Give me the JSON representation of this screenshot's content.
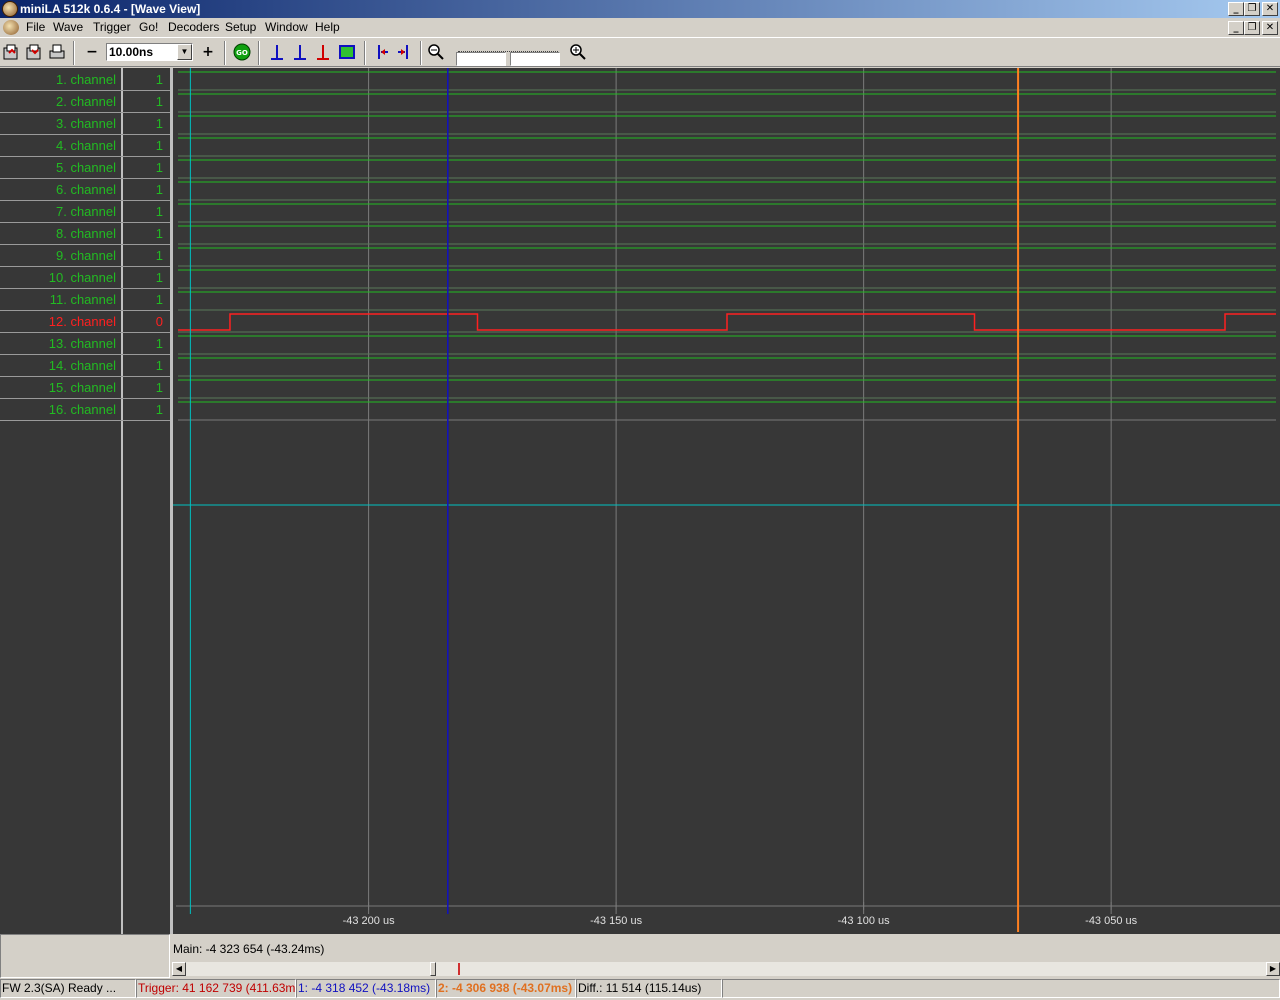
{
  "window": {
    "title": "miniLA 512k 0.6.4 - [Wave View]",
    "controls": [
      "_",
      "❐",
      "✕"
    ]
  },
  "menu": [
    "File",
    "Wave",
    "Trigger",
    "Go!",
    "Decoders",
    "Setup",
    "Window",
    "Help"
  ],
  "toolbar": {
    "zoom_minus": "−",
    "zoom_plus": "+",
    "timebase": "10.00ns",
    "go_label": "GO"
  },
  "channels": [
    {
      "name": "1. channel",
      "value": "1"
    },
    {
      "name": "2. channel",
      "value": "1"
    },
    {
      "name": "3. channel",
      "value": "1"
    },
    {
      "name": "4. channel",
      "value": "1"
    },
    {
      "name": "5. channel",
      "value": "1"
    },
    {
      "name": "6. channel",
      "value": "1"
    },
    {
      "name": "7. channel",
      "value": "1"
    },
    {
      "name": "8. channel",
      "value": "1"
    },
    {
      "name": "9. channel",
      "value": "1"
    },
    {
      "name": "10. channel",
      "value": "1"
    },
    {
      "name": "11. channel",
      "value": "1"
    },
    {
      "name": "12. channel",
      "value": "0"
    },
    {
      "name": "13. channel",
      "value": "1"
    },
    {
      "name": "14. channel",
      "value": "1"
    },
    {
      "name": "15. channel",
      "value": "1"
    },
    {
      "name": "16. channel",
      "value": "1"
    }
  ],
  "highlighted_channel": 12,
  "time_axis": {
    "labels": [
      "-43 200 us",
      "-43 150 us",
      "-43 100 us",
      "-43 050 us"
    ],
    "label_values_us": [
      -43200,
      -43150,
      -43100,
      -43050
    ],
    "view_start_us": -43238.5,
    "view_end_us": -43016.7
  },
  "wave": {
    "channel12_toggles_us": [
      -43228,
      -43178,
      -43127.6,
      -43077.6,
      -43027
    ],
    "channel12_initial_level": 0
  },
  "cursors": {
    "trigger_us": -43236,
    "cursor1_us": -43184,
    "cursor2_us": -43068.8
  },
  "colors": {
    "background": "#373737",
    "signal": "#22bb22",
    "highlight": "#ff2020",
    "grid": "#7a7a7a",
    "trigger": "#00c0c0",
    "cursor1": "#1010c0",
    "cursor2": "#ff8020"
  },
  "main_readout": "Main: -4 323 654  (-43.24ms)",
  "status": {
    "fw": "FW 2.3(SA) Ready ...",
    "trigger": "Trigger: 41 162 739  (411.63ms)",
    "cursor1": "1: -4 318 452  (-43.18ms)",
    "cursor2": "2: -4 306 938  (-43.07ms)",
    "diff": "Diff.: 11 514  (115.14us)"
  }
}
